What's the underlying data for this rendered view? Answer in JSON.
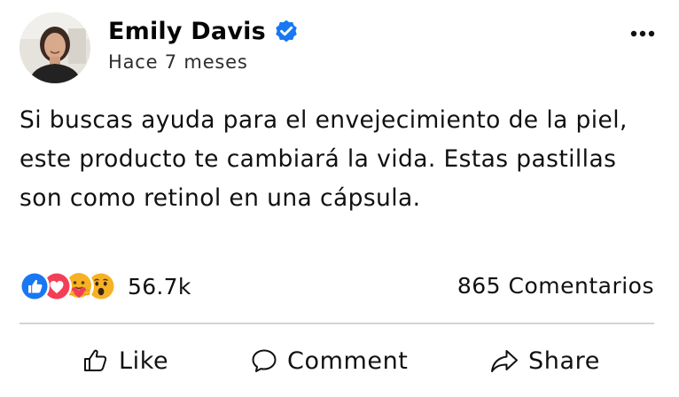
{
  "post": {
    "author": {
      "name": "Emily Davis",
      "verified": true,
      "timestamp": "Hace 7 meses",
      "avatar_icon": "profile-photo"
    },
    "more_icon": "more-horizontal-icon",
    "body": "Si buscas ayuda para el envejecimiento de la piel, este producto te cambiará la vida. Estas pastillas son como retinol en una cápsula.",
    "reactions": {
      "icons": [
        "like-reaction-icon",
        "love-reaction-icon",
        "care-reaction-icon",
        "wow-reaction-icon"
      ],
      "count": "56.7k"
    },
    "comments_count": "865 Comentarios",
    "actions": {
      "like": "Like",
      "comment": "Comment",
      "share": "Share"
    }
  },
  "colors": {
    "verified_badge": "#1877F2",
    "like": "#1877F2",
    "love": "#F33E58",
    "reaction_yellow": "#F7B125",
    "text": "#050505",
    "divider": "#D4D4D4"
  }
}
